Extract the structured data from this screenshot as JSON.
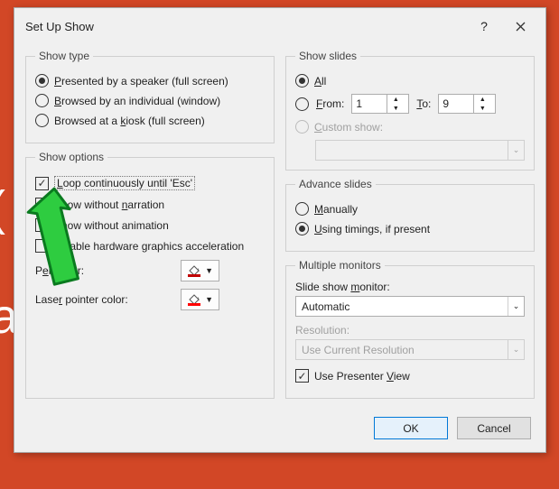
{
  "bg": {
    "t1": "(",
    "t2": "a"
  },
  "dialog": {
    "title": "Set Up Show",
    "help": "?",
    "show_type": {
      "legend": "Show type",
      "options": [
        {
          "pre": "",
          "u": "P",
          "post": "resented by a speaker (full screen)",
          "selected": true
        },
        {
          "pre": "",
          "u": "B",
          "post": "rowsed by an individual (window)",
          "selected": false
        },
        {
          "pre": "Browsed at a ",
          "u": "k",
          "post": "iosk (full screen)",
          "selected": false
        }
      ]
    },
    "show_options": {
      "legend": "Show options",
      "loop": {
        "pre": "",
        "u": "L",
        "post": "oop continuously until 'Esc'",
        "checked": true
      },
      "no_narration": {
        "pre": "Show without ",
        "u": "n",
        "post": "arration",
        "checked": false
      },
      "no_animation": {
        "pre": "Show without animation",
        "checked": false
      },
      "disable_gpu": {
        "pre": "Disable hardware graphics acceleration",
        "checked": false
      },
      "pen_label_pre": "P",
      "pen_label_u": "e",
      "pen_label_post": "n color:",
      "laser_label_pre": "Lase",
      "laser_label_u": "r",
      "laser_label_post": " pointer color:",
      "pen_color": "#C00000",
      "laser_color": "#FF0000"
    },
    "show_slides": {
      "legend": "Show slides",
      "all": {
        "u": "A",
        "post": "ll",
        "selected": true
      },
      "from": {
        "u": "F",
        "post": "rom:",
        "selected": false,
        "value": "1"
      },
      "to": {
        "u": "T",
        "post": "o:",
        "value": "9"
      },
      "custom": {
        "u": "C",
        "post": "ustom show:",
        "disabled": true,
        "value": ""
      }
    },
    "advance": {
      "legend": "Advance slides",
      "manual": {
        "u": "M",
        "post": "anually",
        "selected": false
      },
      "timings": {
        "u": "U",
        "post": "sing timings, if present",
        "selected": true
      }
    },
    "monitors": {
      "legend": "Multiple monitors",
      "monitor_label_pre": "Slide show ",
      "monitor_label_u": "m",
      "monitor_label_post": "onitor:",
      "monitor_value": "Automatic",
      "resolution_label": "Resolution:",
      "resolution_value": "Use Current Resolution",
      "presenter": {
        "pre": "Use Presenter ",
        "u": "V",
        "post": "iew",
        "checked": true
      }
    },
    "buttons": {
      "ok": "OK",
      "cancel": "Cancel"
    }
  }
}
